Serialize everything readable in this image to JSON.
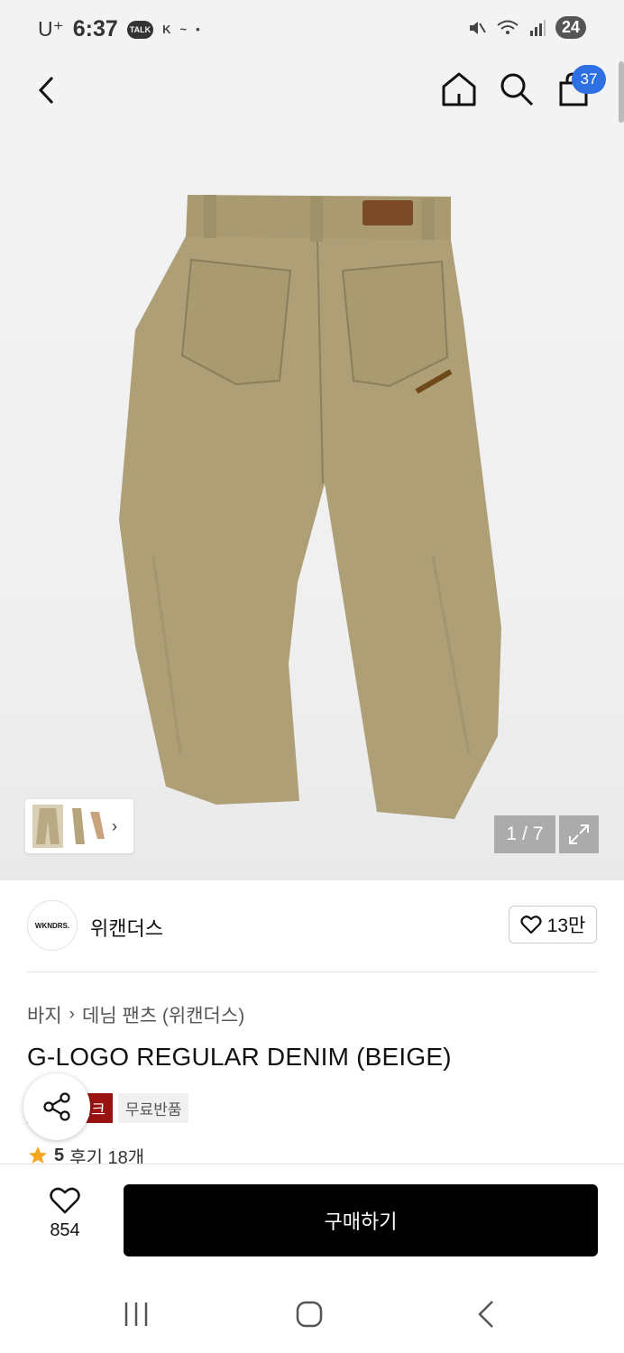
{
  "status_bar": {
    "carrier": "U⁺",
    "time": "6:37",
    "talk_label": "TALK",
    "battery": "24"
  },
  "header": {
    "cart_count": "37"
  },
  "gallery": {
    "page_current": "1",
    "page_sep": "/",
    "page_total": "7"
  },
  "brand": {
    "logo_text": "WKNDRS.",
    "name": "위캔더스",
    "likes": "13만"
  },
  "breadcrumb": {
    "category": "바지",
    "subcategory": "데님 팬츠 (위캔더스)"
  },
  "product": {
    "title": "G-LOGO REGULAR DENIM (BEIGE)",
    "tag_event": "스위크",
    "tag_free_return": "무료반품",
    "rating": "5",
    "reviews": "후기 18개"
  },
  "bottom": {
    "wish_count": "854",
    "buy_label": "구매하기"
  },
  "colors": {
    "accent_blue": "#2f6fe4",
    "tag_red": "#9b1212",
    "star": "#f5a623",
    "pants": "#ae9f77"
  }
}
